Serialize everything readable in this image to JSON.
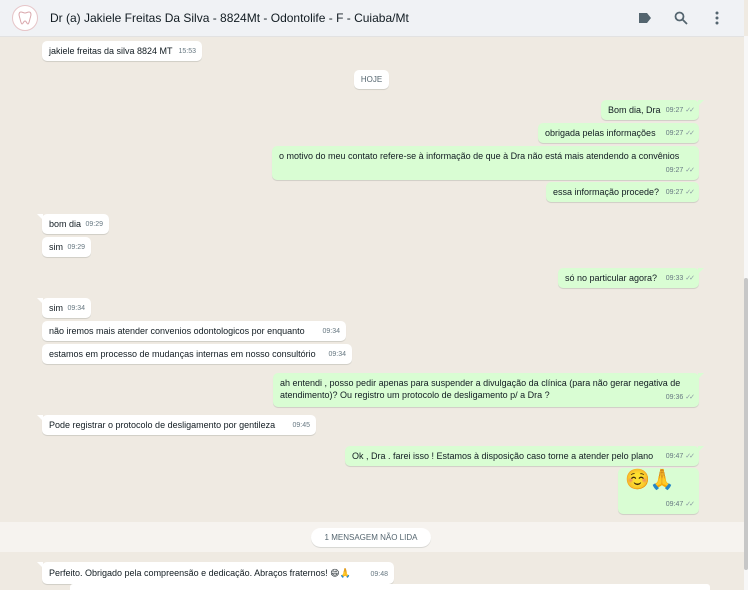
{
  "header": {
    "title": "Dr (a) Jakiele Freitas Da Silva - 8824Mt - Odontolife - F - Cuiaba/Mt",
    "icons": [
      "tooth-avatar",
      "label-icon",
      "search-icon",
      "menu-icon"
    ]
  },
  "colors": {
    "incoming": "#ffffff",
    "outgoing": "#d9fdd3",
    "background": "#efeae2",
    "header": "#f0f2f5"
  },
  "date_divider": "HOJE",
  "unread_divider": "1 MENSAGEM NÃO LIDA",
  "messages": [
    {
      "text": "jakiele freitas da silva 8824 MT",
      "time": "15:53"
    },
    {
      "text": "Bom dia, Dra",
      "time": "09:27"
    },
    {
      "text": "obrigada pelas informações",
      "time": "09:27"
    },
    {
      "text": "o motivo do meu contato refere-se à informação de que à Dra não está mais atendendo a convênios",
      "time": "09:27"
    },
    {
      "text": "essa informação procede?",
      "time": "09:27"
    },
    {
      "text": "bom dia",
      "time": "09:29"
    },
    {
      "text": "sim",
      "time": "09:29"
    },
    {
      "text": "só no particular agora?",
      "time": "09:33"
    },
    {
      "text": "sim",
      "time": "09:34"
    },
    {
      "text": "não iremos mais atender convenios odontologicos por enquanto",
      "time": "09:34"
    },
    {
      "text": "estamos em processo de mudanças internas em nosso consultório",
      "time": "09:34"
    },
    {
      "text": "ah entendi , posso pedir apenas para suspender a divulgação da clínica (para não gerar negativa de atendimento)? Ou registro um protocolo de desligamento p/ a Dra ?",
      "time": "09:36"
    },
    {
      "text": "Pode registrar o protocolo de desligamento por gentileza",
      "time": "09:45"
    },
    {
      "text": "Ok , Dra . farei isso ! Estamos à disposição caso torne a atender pelo plano",
      "time": "09:47"
    },
    {
      "text": "☺️🙏",
      "time": "09:47"
    },
    {
      "text": "Perfeito. Obrigado pela compreensão e dedicação. Abraços fraternos! 😄🙏",
      "time": "09:48"
    }
  ]
}
